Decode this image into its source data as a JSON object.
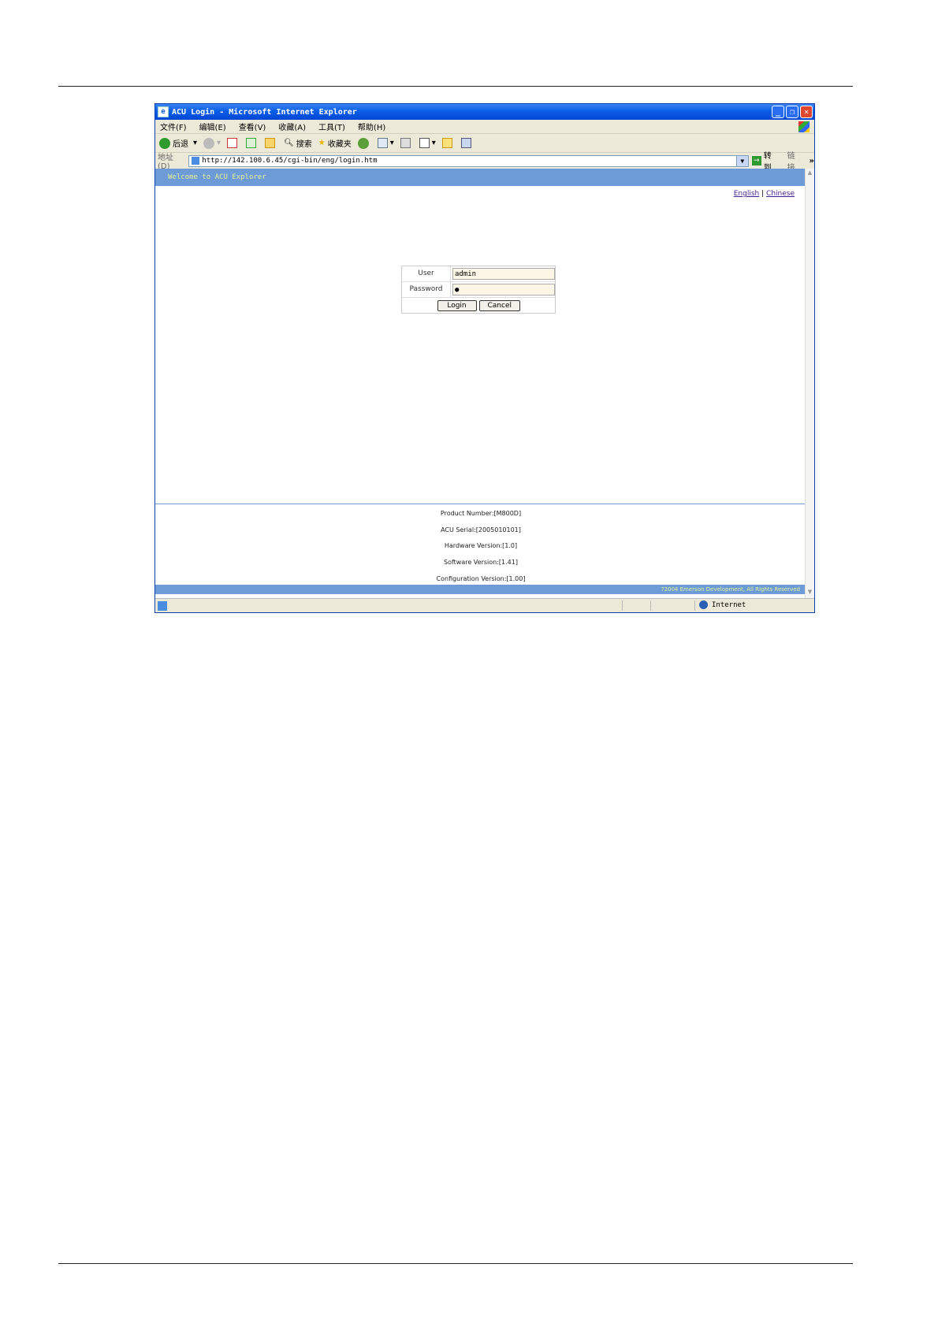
{
  "window": {
    "title": "ACU Login - Microsoft Internet Explorer",
    "controls": {
      "minimize": "_",
      "maximize": "❐",
      "close": "✕"
    }
  },
  "menubar": {
    "items": [
      "文件(F)",
      "编辑(E)",
      "查看(V)",
      "收藏(A)",
      "工具(T)",
      "帮助(H)"
    ]
  },
  "toolbar": {
    "back_label": "后退",
    "search_label": "搜索",
    "favorites_label": "收藏夹"
  },
  "addressbar": {
    "label": "地址(D)",
    "url": "http://142.100.6.45/cgi-bin/eng/login.htm",
    "go_label": "转到",
    "links_label": "链接",
    "chevron": "»"
  },
  "page": {
    "welcome": "Welcome to ACU Explorer",
    "lang_english": "English",
    "lang_separator": "|",
    "lang_chinese": "Chinese",
    "login": {
      "user_label": "User",
      "user_value": "admin",
      "password_label": "Password",
      "password_value": "●",
      "login_button": "Login",
      "cancel_button": "Cancel"
    },
    "info": {
      "product_number": "Product Number:[M800D]",
      "acu_serial": "ACU Serial:[2005010101]",
      "hardware_version": "Hardware Version:[1.0]",
      "software_version": "Software Version:[1.41]",
      "configuration_version": "Configuration Version:[1.00]"
    },
    "copyright": "?2004 Emerson Development, All Rights Reserved"
  },
  "statusbar": {
    "zone": "Internet"
  },
  "colors": {
    "band": "#6d9bd8",
    "band_text": "#e3f29a",
    "titlebar": "#0a5ee6"
  }
}
